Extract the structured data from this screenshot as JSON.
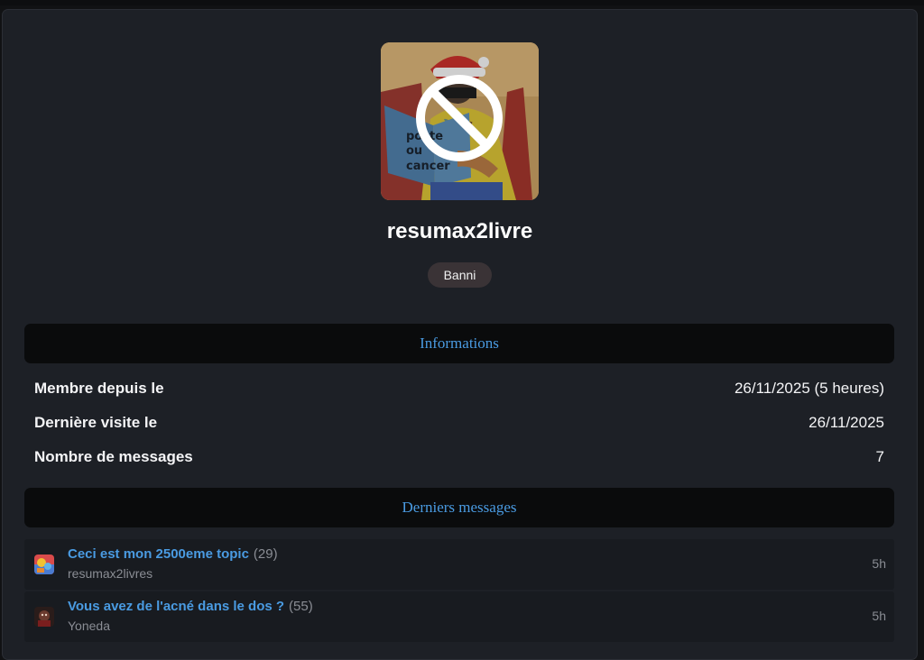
{
  "profile": {
    "username": "resumax2livre",
    "status_badge": "Banni",
    "avatar_book_text": [
      "poste",
      "ou",
      "cancer"
    ]
  },
  "informations": {
    "header": "Informations",
    "rows": [
      {
        "label": "Membre depuis le",
        "value": "26/11/2025 (5 heures)"
      },
      {
        "label": "Dernière visite le",
        "value": "26/11/2025"
      },
      {
        "label": "Nombre de messages",
        "value": "7"
      }
    ]
  },
  "latest_messages": {
    "header": "Derniers messages",
    "items": [
      {
        "title": "Ceci est mon 2500eme topic",
        "count": "(29)",
        "author": "resumax2livres",
        "time": "5h"
      },
      {
        "title": "Vous avez de l'acné dans le dos ?",
        "count": "(55)",
        "author": "Yoneda",
        "time": "5h"
      }
    ]
  },
  "colors": {
    "background": "#111214",
    "card": "#1d2026",
    "section_header": "#0a0b0c",
    "accent_link": "#4a9be2",
    "badge": "#3a3336",
    "muted_text": "#8a8d94"
  }
}
